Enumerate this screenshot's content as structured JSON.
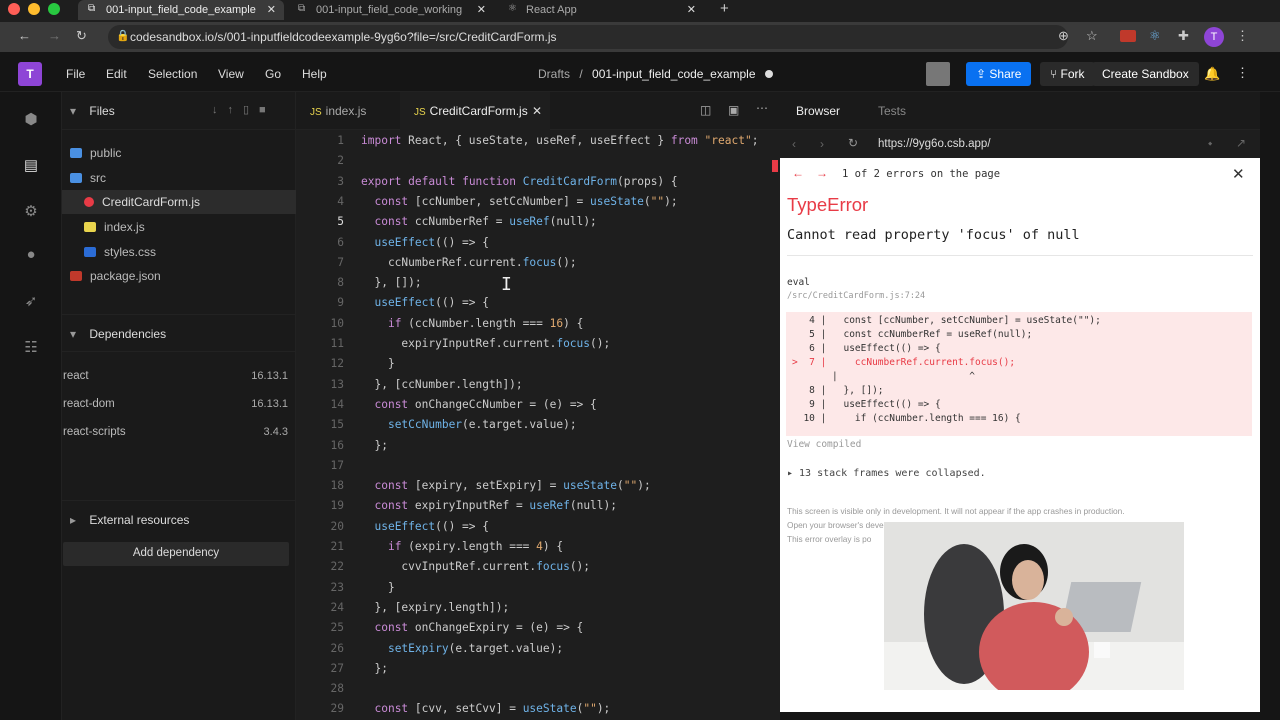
{
  "browser": {
    "tabs": [
      {
        "label": "001-input_field_code_example",
        "active": true
      },
      {
        "label": "001-input_field_code_working",
        "active": false
      },
      {
        "label": "React App",
        "active": false
      }
    ],
    "url": "codesandbox.io/s/001-inputfieldcodeexample-9yg6o?file=/src/CreditCardForm.js"
  },
  "app": {
    "logo": "T",
    "menu": [
      "File",
      "Edit",
      "Selection",
      "View",
      "Go",
      "Help"
    ],
    "breadcrumb_root": "Drafts",
    "breadcrumb_sep": "/",
    "breadcrumb_title": "001-input_field_code_example",
    "share_label": "Share",
    "fork_label": "Fork",
    "create_label": "Create Sandbox"
  },
  "sidebar": {
    "files_title": "Files",
    "tree": [
      {
        "name": "public",
        "kind": "folder"
      },
      {
        "name": "src",
        "kind": "folder"
      },
      {
        "name": "CreditCardForm.js",
        "kind": "file-error"
      },
      {
        "name": "index.js",
        "kind": "js"
      },
      {
        "name": "styles.css",
        "kind": "css"
      },
      {
        "name": "package.json",
        "kind": "json"
      }
    ],
    "deps_title": "Dependencies",
    "deps": [
      {
        "name": "react",
        "version": "16.13.1"
      },
      {
        "name": "react-dom",
        "version": "16.13.1"
      },
      {
        "name": "react-scripts",
        "version": "3.4.3"
      }
    ],
    "add_dep": "Add dependency",
    "external": "External resources"
  },
  "editor": {
    "tabs": [
      {
        "label": "index.js",
        "active": false
      },
      {
        "label": "CreditCardForm.js",
        "active": true
      }
    ],
    "current_line": 5,
    "lines": [
      "import React, { useState, useRef, useEffect } from \"react\";",
      "",
      "export default function CreditCardForm(props) {",
      "  const [ccNumber, setCcNumber] = useState(\"\");",
      "  const ccNumberRef = useRef(null);",
      "  useEffect(() => {",
      "    ccNumberRef.current.focus();",
      "  }, []);",
      "  useEffect(() => {",
      "    if (ccNumber.length === 16) {",
      "      expiryInputRef.current.focus();",
      "    }",
      "  }, [ccNumber.length]);",
      "  const onChangeCcNumber = (e) => {",
      "    setCcNumber(e.target.value);",
      "  };",
      "",
      "  const [expiry, setExpiry] = useState(\"\");",
      "  const expiryInputRef = useRef(null);",
      "  useEffect(() => {",
      "    if (expiry.length === 4) {",
      "      cvvInputRef.current.focus();",
      "    }",
      "  }, [expiry.length]);",
      "  const onChangeExpiry = (e) => {",
      "    setExpiry(e.target.value);",
      "  };",
      "",
      "  const [cvv, setCvv] = useState(\"\");"
    ]
  },
  "preview": {
    "tabs": [
      "Browser",
      "Tests"
    ],
    "url": "https://9yg6o.csb.app/",
    "error_count": "1 of 2 errors on the page",
    "error_type": "TypeError",
    "error_message": "Cannot read property 'focus' of null",
    "location_fn": "eval",
    "location_file": "/src/CreditCardForm.js:7:24",
    "code": [
      {
        "n": "4",
        "text": "  const [ccNumber, setCcNumber] = useState(\"\");"
      },
      {
        "n": "5",
        "text": "  const ccNumberRef = useRef(null);"
      },
      {
        "n": "6",
        "text": "  useEffect(() => {"
      },
      {
        "n": "7",
        "text": "    ccNumberRef.current.focus();",
        "marker": ">"
      },
      {
        "n": "",
        "text": "                      ^"
      },
      {
        "n": "8",
        "text": "  }, []);"
      },
      {
        "n": "9",
        "text": "  useEffect(() => {"
      },
      {
        "n": "10",
        "text": "    if (ccNumber.length === 16) {"
      }
    ],
    "view_compiled": "View compiled",
    "stack_frames": "▸ 13 stack frames were collapsed.",
    "footer_1": "This screen is visible only in development. It will not appear if the app crashes in production.",
    "footer_2": "Open your browser's developer console to further inspect this error.",
    "footer_3": "This error overlay is po"
  },
  "colors": {
    "accent_blue": "#0971f1",
    "brand_purple": "#8e45d6",
    "error_red": "#e83b46"
  }
}
